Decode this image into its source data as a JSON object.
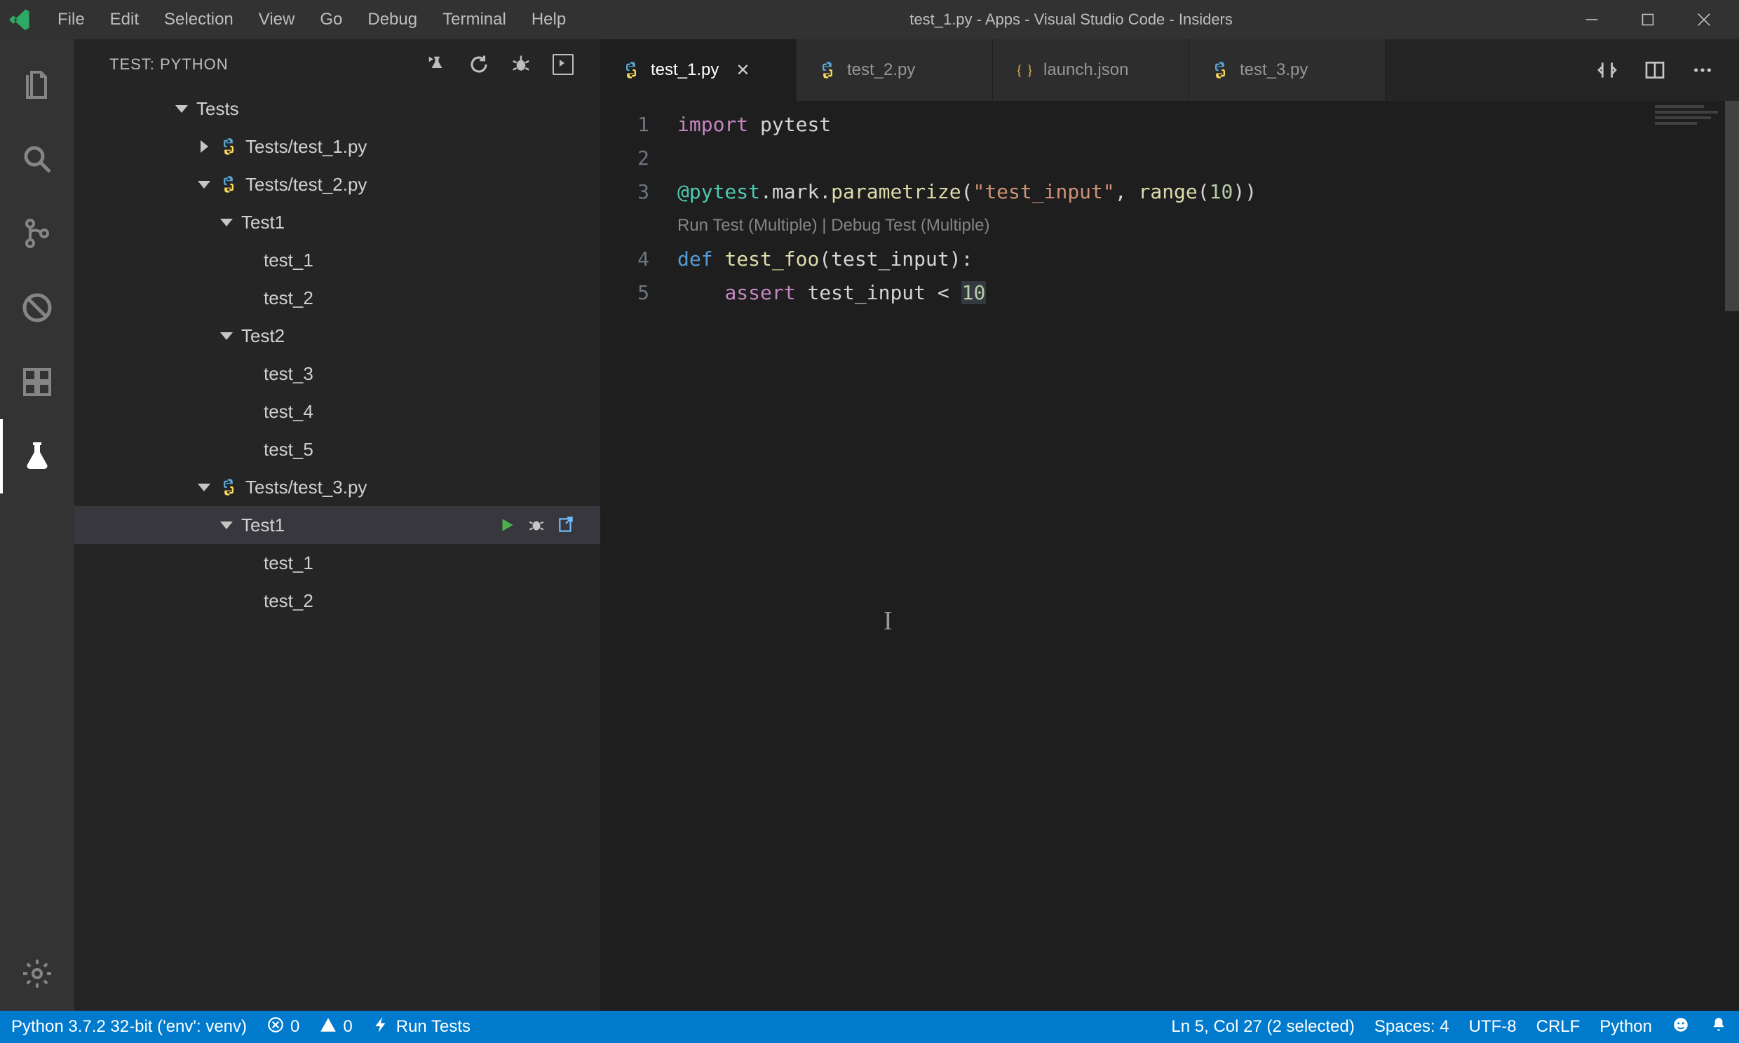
{
  "window": {
    "title": "test_1.py - Apps - Visual Studio Code - Insiders"
  },
  "menu": [
    "File",
    "Edit",
    "Selection",
    "View",
    "Go",
    "Debug",
    "Terminal",
    "Help"
  ],
  "activitybar": {
    "items": [
      {
        "id": "explorer",
        "icon": "files-icon"
      },
      {
        "id": "search",
        "icon": "search-icon"
      },
      {
        "id": "scm",
        "icon": "source-control-icon"
      },
      {
        "id": "debug",
        "icon": "debug-noentry-icon"
      },
      {
        "id": "extensions",
        "icon": "extensions-icon"
      },
      {
        "id": "test",
        "icon": "beaker-icon",
        "active": true
      }
    ],
    "bottom": [
      {
        "id": "settings",
        "icon": "gear-icon"
      }
    ]
  },
  "sidebar": {
    "title": "TEST: PYTHON",
    "actions": [
      "discover-tests-icon",
      "refresh-icon",
      "debug-icon",
      "output-icon"
    ],
    "tree": [
      {
        "depth": 0,
        "twisty": "down",
        "label": "Tests"
      },
      {
        "depth": 1,
        "twisty": "right",
        "icon": "python",
        "label": "Tests/test_1.py"
      },
      {
        "depth": 1,
        "twisty": "down",
        "icon": "python",
        "label": "Tests/test_2.py"
      },
      {
        "depth": 2,
        "twisty": "down",
        "label": "Test1"
      },
      {
        "depth": 3,
        "twisty": "none",
        "label": "test_1"
      },
      {
        "depth": 3,
        "twisty": "none",
        "label": "test_2"
      },
      {
        "depth": 2,
        "twisty": "down",
        "label": "Test2"
      },
      {
        "depth": 3,
        "twisty": "none",
        "label": "test_3"
      },
      {
        "depth": 3,
        "twisty": "none",
        "label": "test_4"
      },
      {
        "depth": 3,
        "twisty": "none",
        "label": "test_5"
      },
      {
        "depth": 1,
        "twisty": "down",
        "icon": "python",
        "label": "Tests/test_3.py"
      },
      {
        "depth": 2,
        "twisty": "down",
        "label": "Test1",
        "selected": true,
        "rowActions": [
          "run-icon",
          "debug-icon",
          "open-icon"
        ]
      },
      {
        "depth": 3,
        "twisty": "none",
        "label": "test_1"
      },
      {
        "depth": 3,
        "twisty": "none",
        "label": "test_2"
      }
    ]
  },
  "tabs": [
    {
      "icon": "python",
      "label": "test_1.py",
      "active": true,
      "close": true
    },
    {
      "icon": "python",
      "label": "test_2.py"
    },
    {
      "icon": "json",
      "label": "launch.json"
    },
    {
      "icon": "python",
      "label": "test_3.py"
    }
  ],
  "tab_actions": [
    "compare-icon",
    "split-icon",
    "more-icon"
  ],
  "editor": {
    "lines": [
      {
        "n": 1,
        "tokens": [
          [
            "kw-import",
            "import"
          ],
          [
            "id",
            " pytest"
          ]
        ]
      },
      {
        "n": 2,
        "tokens": []
      },
      {
        "n": 3,
        "tokens": [
          [
            "at",
            "@pytest"
          ],
          [
            "op",
            "."
          ],
          [
            "id",
            "mark"
          ],
          [
            "op",
            "."
          ],
          [
            "decor",
            "parametrize"
          ],
          [
            "op",
            "("
          ],
          [
            "str",
            "\"test_input\""
          ],
          [
            "op",
            ", "
          ],
          [
            "fn",
            "range"
          ],
          [
            "op",
            "("
          ],
          [
            "num",
            "10"
          ],
          [
            "op",
            "))"
          ]
        ]
      },
      {
        "codelens": "Run Test (Multiple) | Debug Test (Multiple)"
      },
      {
        "n": 4,
        "tokens": [
          [
            "kw-def",
            "def"
          ],
          [
            "id",
            " "
          ],
          [
            "fn",
            "test_foo"
          ],
          [
            "op",
            "("
          ],
          [
            "id",
            "test_input"
          ],
          [
            "op",
            "):"
          ]
        ]
      },
      {
        "n": 5,
        "tokens": [
          [
            "id",
            "    "
          ],
          [
            "kw-import",
            "assert"
          ],
          [
            "id",
            " test_input "
          ],
          [
            "op",
            "<"
          ],
          [
            "id",
            " "
          ],
          [
            "sel",
            "10"
          ]
        ]
      }
    ]
  },
  "statusbar": {
    "left": [
      {
        "label": "Python 3.7.2 32-bit ('env': venv)"
      },
      {
        "icon": "error-icon",
        "label": "0"
      },
      {
        "icon": "warning-icon",
        "label": "0"
      },
      {
        "icon": "zap-icon",
        "label": "Run Tests"
      }
    ],
    "right": [
      {
        "label": "Ln 5, Col 27 (2 selected)"
      },
      {
        "label": "Spaces: 4"
      },
      {
        "label": "UTF-8"
      },
      {
        "label": "CRLF"
      },
      {
        "label": "Python"
      },
      {
        "icon": "smiley-icon"
      },
      {
        "icon": "bell-icon"
      }
    ]
  },
  "colors": {
    "accent": "#007acc",
    "run": "#4caf50"
  }
}
